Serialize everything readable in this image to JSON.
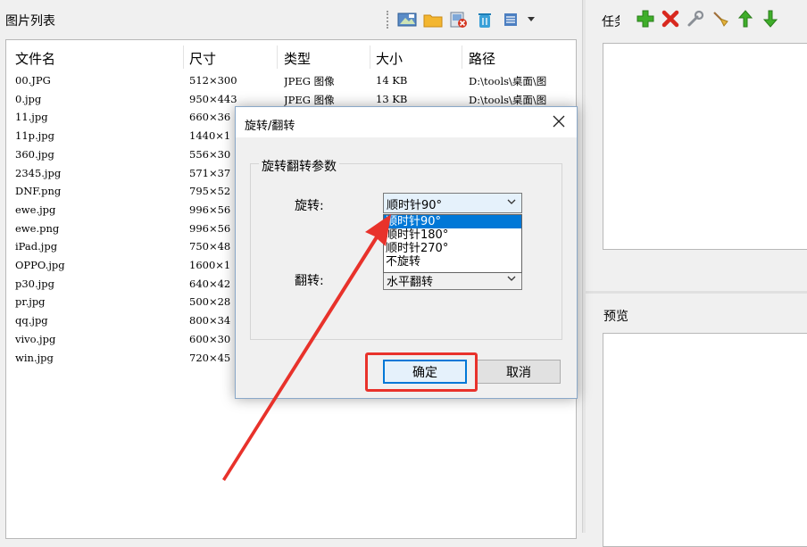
{
  "left_panel": {
    "title": "图片列表",
    "toolbar_icons": [
      "add-image-icon",
      "folder-icon",
      "remove-image-icon",
      "trash-icon",
      "list-view-icon",
      "dropdown-caret-icon"
    ]
  },
  "file_list": {
    "columns": [
      "文件名",
      "尺寸",
      "类型",
      "大小",
      "路径"
    ],
    "rows": [
      {
        "name": "00.JPG",
        "size": "512×300",
        "type": "JPEG 图像",
        "bytes": "14 KB",
        "path": "D:\\tools\\桌面\\图"
      },
      {
        "name": "0.jpg",
        "size": "950×443",
        "type": "JPEG 图像",
        "bytes": "13 KB",
        "path": "D:\\tools\\桌面\\图"
      },
      {
        "name": "11.jpg",
        "size": "660×36",
        "type": "",
        "bytes": "",
        "path": ""
      },
      {
        "name": "11p.jpg",
        "size": "1440×1",
        "type": "",
        "bytes": "",
        "path": ""
      },
      {
        "name": "360.jpg",
        "size": "556×30",
        "type": "",
        "bytes": "",
        "path": ""
      },
      {
        "name": "2345.jpg",
        "size": "571×37",
        "type": "",
        "bytes": "",
        "path": ""
      },
      {
        "name": "DNF.png",
        "size": "795×52",
        "type": "",
        "bytes": "",
        "path": ""
      },
      {
        "name": "ewe.jpg",
        "size": "996×56",
        "type": "",
        "bytes": "",
        "path": ""
      },
      {
        "name": "ewe.png",
        "size": "996×56",
        "type": "",
        "bytes": "",
        "path": ""
      },
      {
        "name": "iPad.jpg",
        "size": "750×48",
        "type": "",
        "bytes": "",
        "path": ""
      },
      {
        "name": "OPPO.jpg",
        "size": "1600×1",
        "type": "",
        "bytes": "",
        "path": ""
      },
      {
        "name": "p30.jpg",
        "size": "640×42",
        "type": "",
        "bytes": "",
        "path": ""
      },
      {
        "name": "pr.jpg",
        "size": "500×28",
        "type": "",
        "bytes": "",
        "path": ""
      },
      {
        "name": "qq.jpg",
        "size": "800×34",
        "type": "",
        "bytes": "",
        "path": ""
      },
      {
        "name": "vivo.jpg",
        "size": "600×30",
        "type": "",
        "bytes": "",
        "path": ""
      },
      {
        "name": "win.jpg",
        "size": "720×45",
        "type": "",
        "bytes": "",
        "path": ""
      }
    ]
  },
  "right_panel": {
    "task_title": "任务",
    "task_icons": [
      "add-icon",
      "delete-icon",
      "wrench-icon",
      "broom-icon",
      "move-up-icon",
      "move-down-icon"
    ],
    "preview_label": "预览"
  },
  "dialog": {
    "title": "旋转/翻转",
    "group_label": "旋转翻转参数",
    "rotate_label": "旋转:",
    "rotate_value": "顺时针90°",
    "rotate_options": [
      "顺时针90°",
      "顺时针180°",
      "顺时针270°",
      "不旋转"
    ],
    "flip_label": "翻转:",
    "flip_value": "水平翻转",
    "ok_label": "确定",
    "cancel_label": "取消"
  },
  "annotation": {
    "highlight_color": "#e8322b",
    "arrow_color": "#e8322b"
  }
}
